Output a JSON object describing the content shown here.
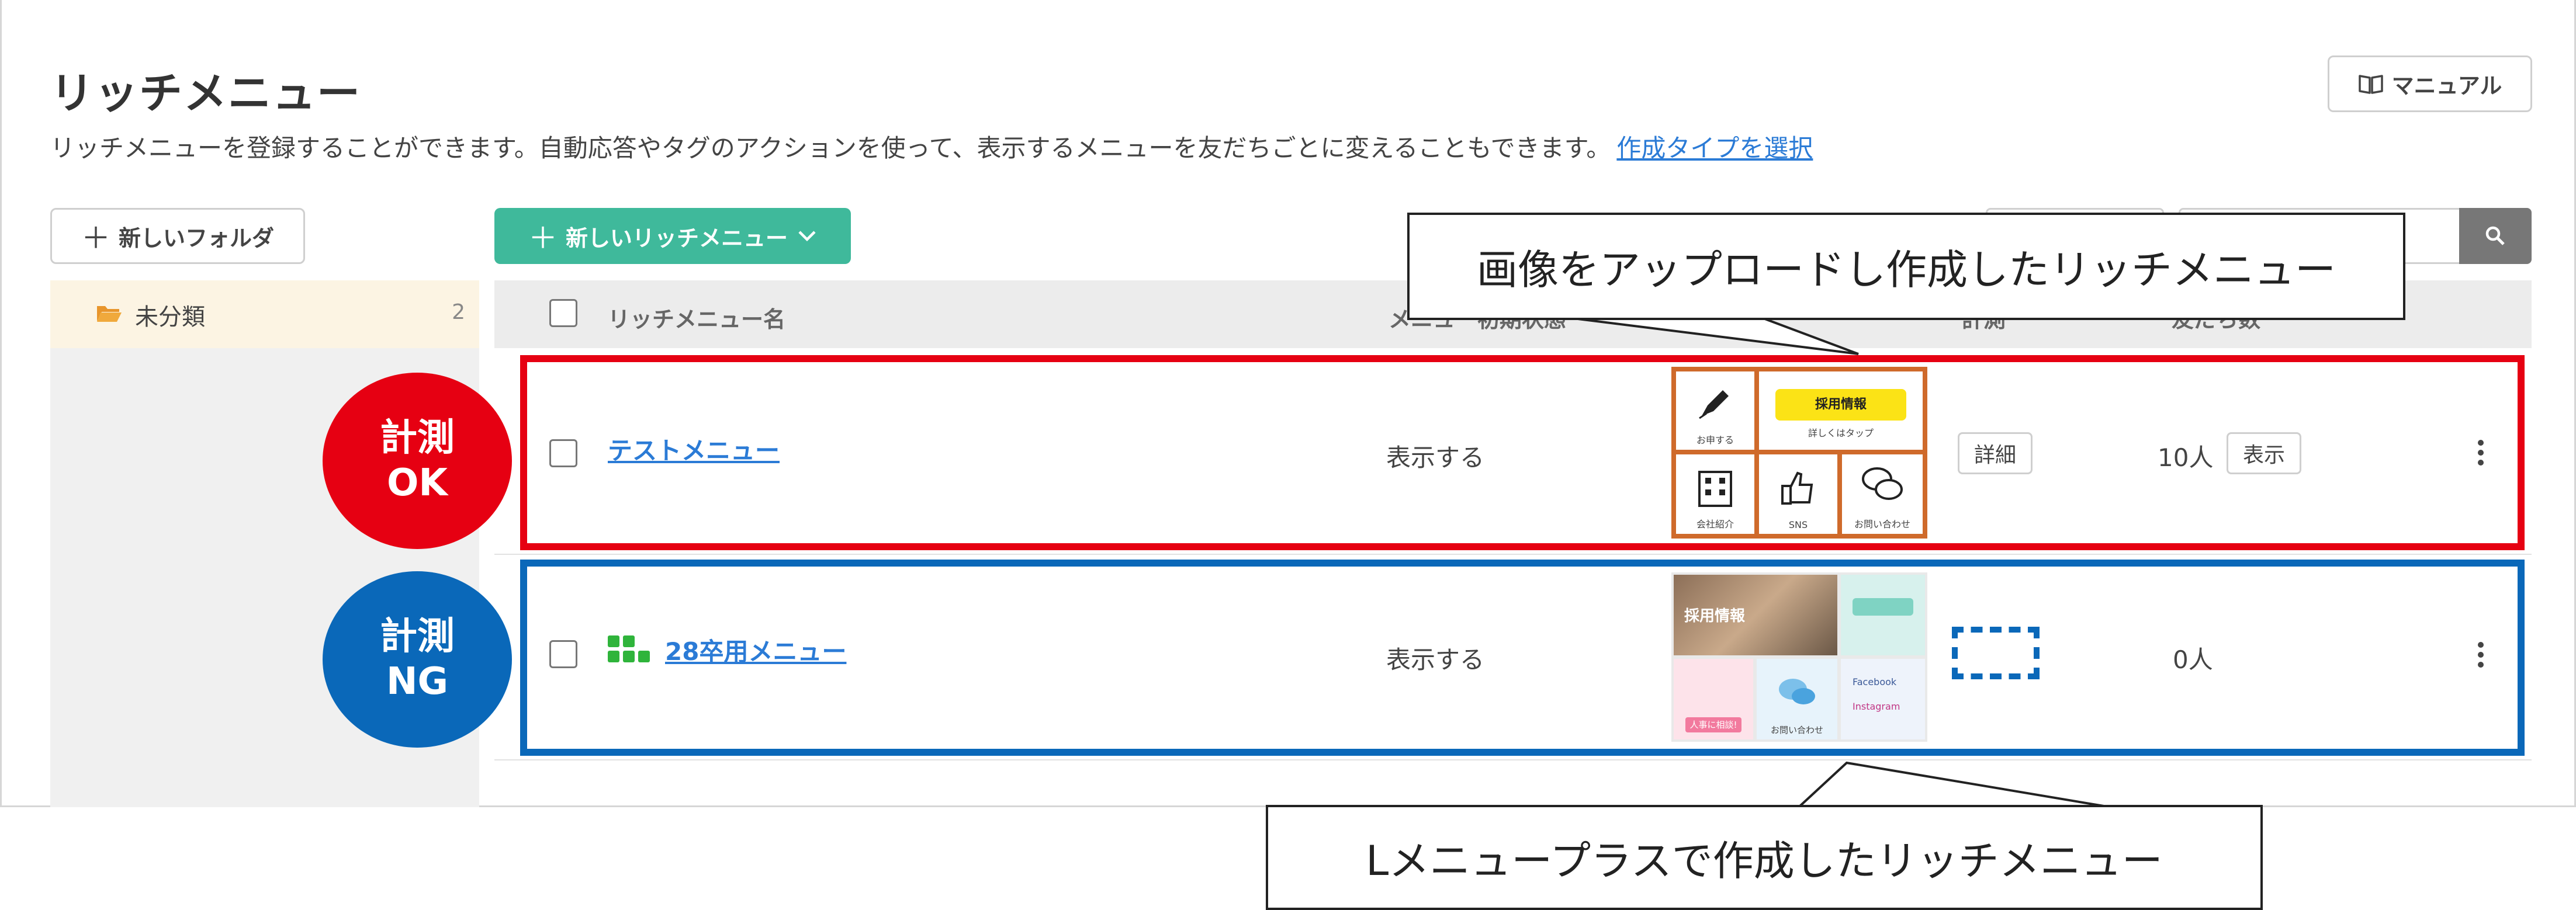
{
  "page": {
    "title": "リッチメニュー",
    "description": "リッチメニューを登録することができます。自動応答やタグのアクションを使って、表示するメニューを友だちごとに変えることもできます。",
    "description_link": "作成タイプを選択",
    "manual_label": "マニュアル"
  },
  "toolbar": {
    "new_folder_label": "新しいフォルダ",
    "new_menu_label": "新しいリッチメニュー",
    "search_placeholder": ""
  },
  "sidebar": {
    "folders": [
      {
        "label": "未分類",
        "count": "2"
      }
    ]
  },
  "table": {
    "headers": {
      "name": "リッチメニュー名",
      "initial_state": "メニュー初期状態",
      "measure": "計測",
      "friends": "友だち数"
    },
    "rows": [
      {
        "name": "テストメニュー",
        "state": "表示する",
        "detail_label": "詳細",
        "friends": "10人",
        "show_label": "表示"
      },
      {
        "name": "28卒用メニュー",
        "state": "表示する",
        "friends": "0人"
      }
    ]
  },
  "thumb1": {
    "cells": [
      "お申する",
      "採用情報",
      "会社紹介",
      "SNS",
      "お問い合わせ"
    ],
    "banner_sub": "詳しくはタップ"
  },
  "thumb2": {
    "cells": [
      "採用情報",
      "Facebook",
      "Instagram",
      "お問い合わせ",
      "人事に相談!"
    ]
  },
  "annotations": {
    "badge_ok_line1": "計測",
    "badge_ok_line2": "OK",
    "badge_ng_line1": "計測",
    "badge_ng_line2": "NG",
    "callout_top": "画像をアップロードし作成したリッチメニュー",
    "callout_bottom": "Lメニュープラスで作成したリッチメニュー",
    "colors": {
      "ok": "#e60012",
      "ng": "#0a68b9",
      "primary": "#3fb99b",
      "link": "#2b7bd6"
    }
  }
}
